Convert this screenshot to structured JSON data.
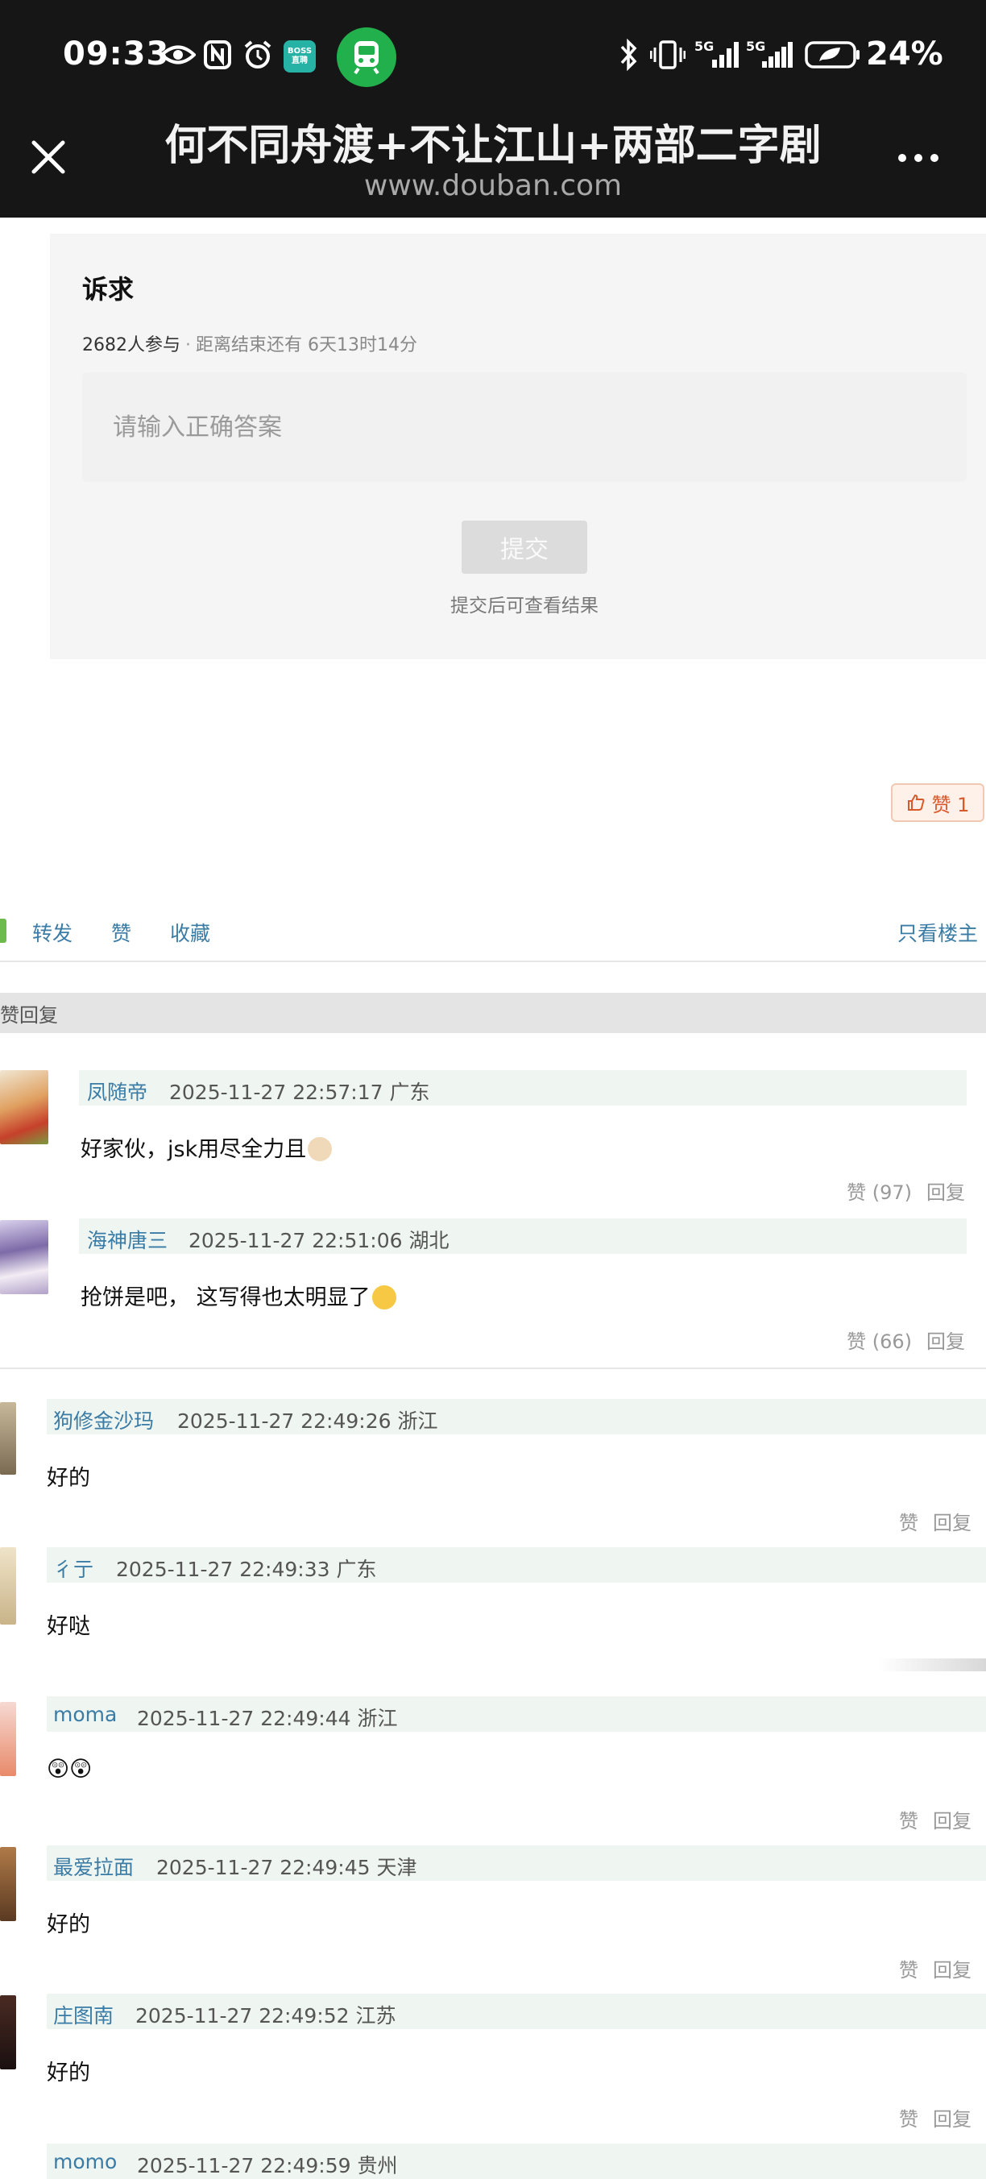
{
  "status_bar": {
    "time": "09:33",
    "boss_badge": "BOSS直聘",
    "net1": "5G",
    "net2": "5G",
    "battery": "24%"
  },
  "header": {
    "title": "何不同舟渡+不让江山+两部二字剧",
    "domain": "www.douban.com"
  },
  "quiz": {
    "title": "诉求",
    "participants": "2682人参与",
    "separator": "·",
    "deadline": "距离结束还有 6天13时14分",
    "input_placeholder": "请输入正确答案",
    "submit_label": "提交",
    "submit_note": "提交后可查看结果"
  },
  "like_badge": {
    "label": "赞 1"
  },
  "actions": {
    "forward": "转发",
    "like": "赞",
    "collect": "收藏",
    "op_only": "只看楼主"
  },
  "section": {
    "label": "赞回复"
  },
  "comments_top": [
    {
      "author": "凤随帝",
      "time": "2025-11-27 22:57:17 广东",
      "text": "好家伙，jsk用尽全力且",
      "likes": "赞 (97)",
      "reply": "回复"
    },
    {
      "author": "海神唐三",
      "time": "2025-11-27 22:51:06 湖北",
      "text": "抢饼是吧， 这写得也太明显了",
      "likes": "赞 (66)",
      "reply": "回复"
    }
  ],
  "comments": [
    {
      "author": "狗修金沙玛",
      "time": "2025-11-27 22:49:26 浙江",
      "text": "好的",
      "likes": "赞",
      "reply": "回复"
    },
    {
      "author": "彳亍",
      "time": "2025-11-27 22:49:33 广东",
      "text": "好哒",
      "likes": "",
      "reply": ""
    },
    {
      "author": "moma",
      "time": "2025-11-27 22:49:44 浙江",
      "text": "😲😲",
      "likes": "赞",
      "reply": "回复"
    },
    {
      "author": "最爱拉面",
      "time": "2025-11-27 22:49:45 天津",
      "text": "好的",
      "likes": "赞",
      "reply": "回复"
    },
    {
      "author": "庄图南",
      "time": "2025-11-27 22:49:52 江苏",
      "text": "好的",
      "likes": "赞",
      "reply": "回复"
    },
    {
      "author": "momo",
      "time": "2025-11-27 22:49:59 贵州",
      "text": "",
      "likes": "",
      "reply": ""
    }
  ],
  "colors": {
    "topbar_bg": "#161616",
    "link_blue": "#3a7ca5",
    "meta_bar_bg": "#eff5f1",
    "like_badge_accent": "#d9592b",
    "train_green": "#22b04c"
  },
  "icons": [
    "eye-icon",
    "nfc-icon",
    "alarm-icon",
    "train-icon",
    "bluetooth-icon",
    "vibrate-icon",
    "signal-icon",
    "battery-icon",
    "close-icon",
    "more-icon",
    "thumbs-up-icon"
  ]
}
